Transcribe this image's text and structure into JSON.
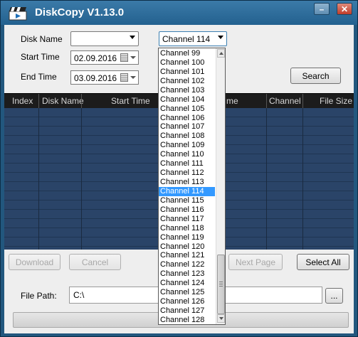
{
  "window": {
    "title": "DiskCopy V1.13.0"
  },
  "form": {
    "disk_name_label": "Disk Name",
    "disk_name_value": "",
    "channel_value": "Channel 114",
    "start_time_label": "Start Time",
    "start_time_value": "02.09.2016",
    "end_time_label": "End Time",
    "end_time_value": "03.09.2016",
    "search_label": "Search"
  },
  "table": {
    "columns": [
      "Index",
      "Disk Name",
      "Start Time",
      "me",
      "Channel",
      "File Size"
    ],
    "rows": []
  },
  "actions": {
    "download_label": "Download",
    "cancel_label": "Cancel",
    "next_page_label": "Next Page",
    "select_all_label": "Select All"
  },
  "file_path": {
    "label": "File Path:",
    "value": "C:\\",
    "browse_label": "..."
  },
  "channel_dropdown": {
    "selected": "Channel 114",
    "options": [
      "Channel 99",
      "Channel 100",
      "Channel 101",
      "Channel 102",
      "Channel 103",
      "Channel 104",
      "Channel 105",
      "Channel 106",
      "Channel 107",
      "Channel 108",
      "Channel 109",
      "Channel 110",
      "Channel 111",
      "Channel 112",
      "Channel 113",
      "Channel 114",
      "Channel 115",
      "Channel 116",
      "Channel 117",
      "Channel 118",
      "Channel 119",
      "Channel 120",
      "Channel 121",
      "Channel 122",
      "Channel 123",
      "Channel 124",
      "Channel 125",
      "Channel 126",
      "Channel 127",
      "Channel 128"
    ]
  },
  "colors": {
    "title_bar": "#2b6b9a",
    "table_bg": "#2a4468",
    "selection": "#3399ff"
  },
  "icons": {
    "app": "film-clapper-icon"
  }
}
